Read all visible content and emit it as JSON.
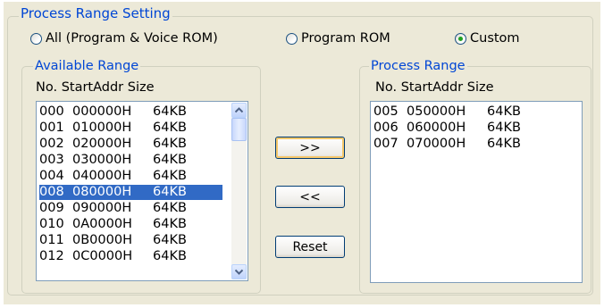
{
  "group": {
    "title": "Process Range Setting",
    "options": [
      {
        "label": "All (Program & Voice ROM)",
        "checked": false
      },
      {
        "label": "Program ROM",
        "checked": false
      },
      {
        "label": "Custom",
        "checked": true
      }
    ]
  },
  "available": {
    "title": "Available Range",
    "headers": [
      "No.",
      "StartAddr",
      "Size"
    ],
    "rows": [
      {
        "no": "000",
        "addr": "000000H",
        "size": "64KB",
        "selected": false
      },
      {
        "no": "001",
        "addr": "010000H",
        "size": "64KB",
        "selected": false
      },
      {
        "no": "002",
        "addr": "020000H",
        "size": "64KB",
        "selected": false
      },
      {
        "no": "003",
        "addr": "030000H",
        "size": "64KB",
        "selected": false
      },
      {
        "no": "004",
        "addr": "040000H",
        "size": "64KB",
        "selected": false
      },
      {
        "no": "008",
        "addr": "080000H",
        "size": "64KB",
        "selected": true
      },
      {
        "no": "009",
        "addr": "090000H",
        "size": "64KB",
        "selected": false
      },
      {
        "no": "010",
        "addr": "0A0000H",
        "size": "64KB",
        "selected": false
      },
      {
        "no": "011",
        "addr": "0B0000H",
        "size": "64KB",
        "selected": false
      },
      {
        "no": "012",
        "addr": "0C0000H",
        "size": "64KB",
        "selected": false
      }
    ]
  },
  "process": {
    "title": "Process Range",
    "headers": [
      "No.",
      "StartAddr",
      "Size"
    ],
    "rows": [
      {
        "no": "005",
        "addr": "050000H",
        "size": "64KB"
      },
      {
        "no": "006",
        "addr": "060000H",
        "size": "64KB"
      },
      {
        "no": "007",
        "addr": "070000H",
        "size": "64KB"
      }
    ]
  },
  "buttons": {
    "add": ">>",
    "remove": "<<",
    "reset": "Reset"
  },
  "icons": {
    "scroll_up": "scroll-up-arrow-icon",
    "scroll_down": "scroll-down-arrow-icon"
  },
  "colors": {
    "legend": "#0046d5",
    "selection": "#316ac5",
    "panel": "#ece9d8",
    "radio_dot": "#21a121"
  }
}
